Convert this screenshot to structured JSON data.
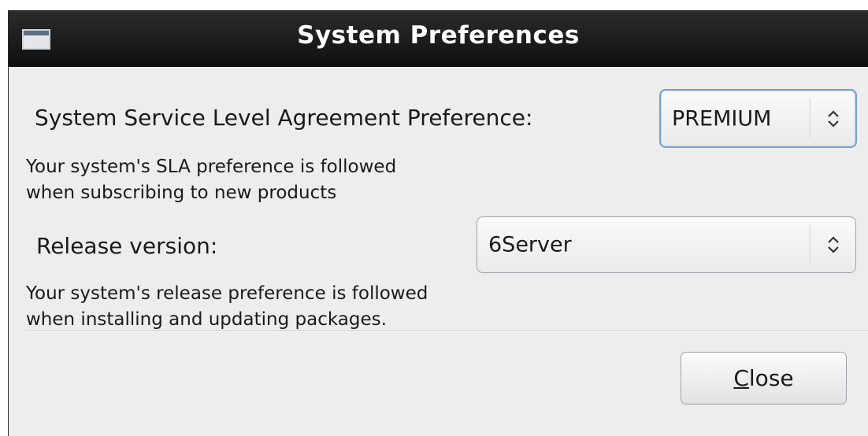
{
  "window": {
    "title": "System Preferences",
    "icon": "window-icon"
  },
  "sla": {
    "label": "System Service Level Agreement Preference:",
    "selected_value": "PREMIUM",
    "hint_line1": "Your system's SLA preference is followed",
    "hint_line2": "when subscribing to new products"
  },
  "release": {
    "label": "Release version:",
    "selected_value": "6Server",
    "hint_line1": "Your system's release preference is followed",
    "hint_line2": "when installing and updating packages."
  },
  "buttons": {
    "close_mnemonic": "C",
    "close_rest": "lose"
  },
  "colors": {
    "titlebar": "#1a1a1a",
    "dialog_bg": "#ededed",
    "focus_ring": "#7d9ec7"
  }
}
